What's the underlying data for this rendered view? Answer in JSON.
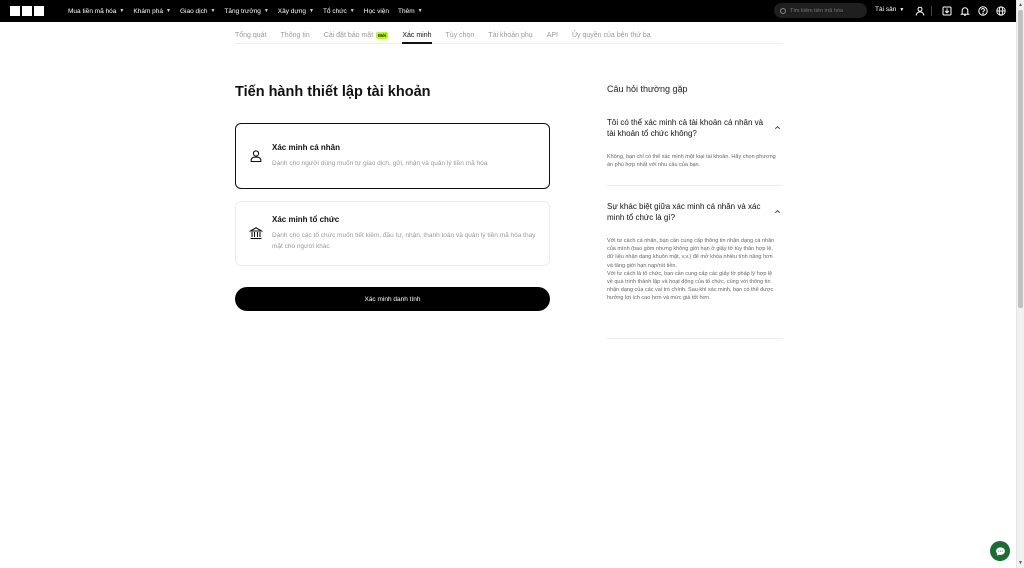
{
  "topbar": {
    "nav": [
      {
        "label": "Mua tiền mã hóa",
        "has_chevron": true
      },
      {
        "label": "Khám phá",
        "has_chevron": true
      },
      {
        "label": "Giao dịch",
        "has_chevron": true
      },
      {
        "label": "Tăng trưởng",
        "has_chevron": true
      },
      {
        "label": "Xây dựng",
        "has_chevron": true
      },
      {
        "label": "Tổ chức",
        "has_chevron": true
      },
      {
        "label": "Học viện",
        "has_chevron": false
      },
      {
        "label": "Thêm",
        "has_chevron": true
      }
    ],
    "search_placeholder": "Tìm kiếm tiền mã hóa",
    "assets_label": "Tài sản",
    "icons": [
      "user-icon",
      "download-icon",
      "bell-icon",
      "help-icon",
      "globe-icon"
    ]
  },
  "tabs": [
    {
      "label": "Tổng quát",
      "active": false
    },
    {
      "label": "Thông tin",
      "active": false
    },
    {
      "label": "Cài đặt bảo mật",
      "active": false,
      "badge": "Mới"
    },
    {
      "label": "Xác minh",
      "active": true
    },
    {
      "label": "Tùy chọn",
      "active": false
    },
    {
      "label": "Tài khoản phụ",
      "active": false
    },
    {
      "label": "API",
      "active": false
    },
    {
      "label": "Ủy quyền của bên thứ ba",
      "active": false
    }
  ],
  "main": {
    "title": "Tiến hành thiết lập tài khoản",
    "cards": [
      {
        "title": "Xác minh cá nhân",
        "description": "Dành cho người dùng muốn tự giao dịch, gửi, nhận và quản lý tiền mã hóa",
        "icon": "person-icon",
        "selected": true
      },
      {
        "title": "Xác minh tổ chức",
        "description": "Dành cho các tổ chức muốn tiết kiệm, đầu tư, nhận, thanh toán và quản lý tiền mã hóa thay mặt cho người khác",
        "icon": "institution-icon",
        "selected": false
      }
    ],
    "cta_label": "Xác minh danh tính"
  },
  "faq": {
    "title": "Câu hỏi thường gặp",
    "items": [
      {
        "question": "Tôi có thể xác minh cả tài khoản cá nhân và tài khoản tổ chức không?",
        "answer": "Không, bạn chỉ có thể xác minh một loại tài khoản. Hãy chọn phương án phù hợp nhất với nhu cầu của bạn.",
        "expanded": true
      },
      {
        "question": "Sự khác biệt giữa xác minh cá nhân và xác minh tổ chức là gì?",
        "answer": "Với tư cách cá nhân, bạn cần cung cấp thông tin nhận dạng cá nhân của mình (bao gồm nhưng không giới hạn ở giấy tờ tùy thân hợp lệ, dữ liệu nhận dạng khuôn mặt, v.v.) để mở khóa nhiều tính năng hơn và tăng giới hạn nạp/rút tiền.\nVới tư cách là tổ chức, bạn cần cung cấp các giấy tờ pháp lý hợp lệ về quá trình thành lập và hoạt động của tổ chức, cùng với thông tin nhận dạng của các vai trò chính. Sau khi xác minh, bạn có thể được hưởng lợi ích cao hơn và mức giá tốt hơn.",
        "expanded": true
      }
    ]
  },
  "colors": {
    "topbar_bg": "#000000",
    "badge_bg": "#b8f52a",
    "cta_bg": "#000000",
    "chat_bg": "#1e6b36"
  }
}
